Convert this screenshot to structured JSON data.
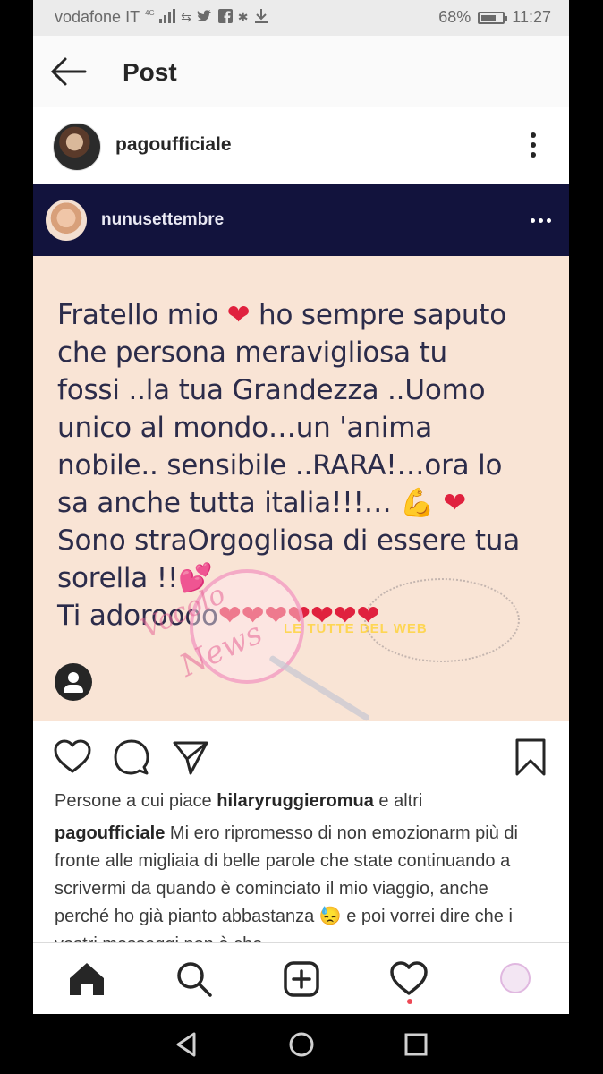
{
  "status_bar": {
    "carrier": "vodafone IT",
    "network": "4G",
    "battery": "68%",
    "time": "11:27",
    "icons": [
      "signal-icon",
      "retweet-icon",
      "twitter-icon",
      "facebook-icon",
      "snowflake-icon",
      "download-icon",
      "battery-icon"
    ]
  },
  "header": {
    "title": "Post",
    "back_icon": "arrow-left-icon"
  },
  "post": {
    "username": "pagoufficiale",
    "embedded": {
      "username": "nunusettembre",
      "quote_lines": [
        "Fratello mio ❤ ho sempre saputo",
        "che persona meravigliosa tu",
        "fossi ..la tua Grandezza ..Uomo",
        "unico al mondo…un 'anima",
        "nobile.. sensibile ..RARA!…ora lo",
        "sa anche tutta italia!!!… 💪 ❤",
        "Sono straOrgogliosa di essere tua",
        "sorella !!💕",
        "Ti adoroooo❤❤❤❤❤❤❤"
      ],
      "watermark": {
        "line1": "Vocolo",
        "line2": "News",
        "tag": "LE TUTTE DEL WEB"
      }
    },
    "likes_prefix": "Persone a cui piace",
    "likes_user": "hilaryruggieromua",
    "likes_suffix": "e altri",
    "caption_user": "pagoufficiale",
    "caption_text": "Mi ero ripromesso di non emozionarm più di fronte alle migliaia di belle parole che state continuando a scrivermi da quando è cominciato il mio viaggio, anche perché ho già pianto abbastanza 😓 e poi vorrei dire che i vostri messaggi non è che"
  },
  "colors": {
    "embed_header": "#12133d",
    "embed_bg": "#f9e4d5",
    "heart": "#e0213e",
    "notification": "#ed4956"
  }
}
